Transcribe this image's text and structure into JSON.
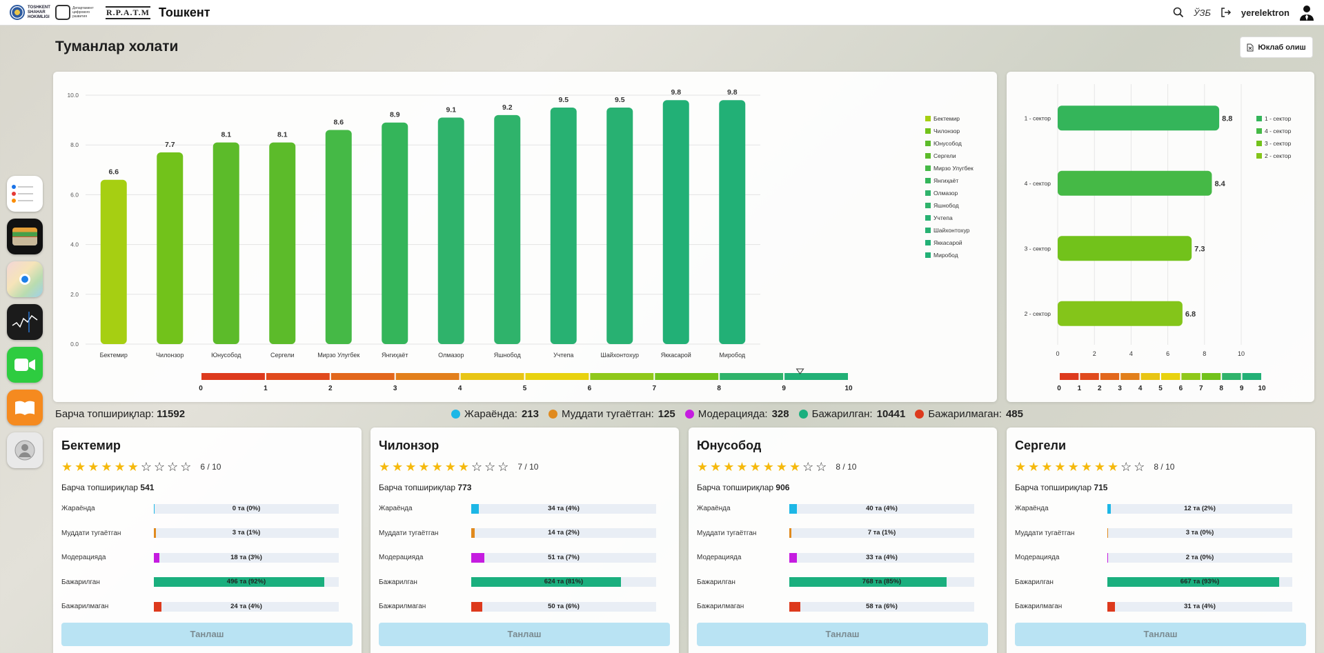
{
  "header": {
    "logo1_text": "TOSHKENT SHAHAR HOKIMLIGI",
    "logo2_text": "Департамент цифрового развития",
    "logo3_text": "R.P.A.T.M",
    "city": "Тошкент",
    "lang": "ЎЗБ",
    "user": "yerelektron"
  },
  "page": {
    "title": "Туманлар холати",
    "download_label": "Юклаб олиш"
  },
  "colors": {
    "lime": "#a6cf12",
    "green_light": "#72c21b",
    "green_mid": "#5cbb2a",
    "green_teal": "#2fb36b",
    "teal": "#1aaf7e",
    "blue": "#1db7e6",
    "orange": "#e08a1e",
    "magenta": "#c51ce0",
    "red": "#dd3a1d"
  },
  "chart_data": [
    {
      "type": "bar",
      "categories": [
        "Бектемир",
        "Чилонзор",
        "Юнусобод",
        "Сергели",
        "Мирзо Улугбек",
        "Янгиҳаёт",
        "Олмазор",
        "Яшнобод",
        "Учтепа",
        "Шайхонтохур",
        "Яккасарой",
        "Миробод"
      ],
      "values": [
        6.6,
        7.7,
        8.1,
        8.1,
        8.6,
        8.9,
        9.1,
        9.2,
        9.5,
        9.5,
        9.8,
        9.8
      ],
      "value_labels": [
        "6.6",
        "7.7",
        "8.1",
        "8.1",
        "8.6",
        "8.9",
        "9.1",
        "9.2",
        "9.5",
        "9.5",
        "9.8",
        "9.8"
      ],
      "bar_colors": [
        "#a6cf12",
        "#72c21b",
        "#5cbb2a",
        "#5cbb2a",
        "#45b946",
        "#34b55a",
        "#2fb36b",
        "#2fb36b",
        "#28b172",
        "#28b172",
        "#22b076",
        "#22b076"
      ],
      "yticks": [
        "0.0",
        "2.0",
        "4.0",
        "6.0",
        "8.0",
        "10.0"
      ],
      "ylim": [
        0,
        10
      ],
      "grid": true,
      "legend": "right",
      "scale_labels": [
        "0",
        "1",
        "2",
        "3",
        "4",
        "5",
        "6",
        "7",
        "8",
        "9",
        "10"
      ],
      "scale_colors": [
        "#dd3a1d",
        "#e04a1d",
        "#e2671c",
        "#e27f1b",
        "#e8c514",
        "#e8d20f",
        "#8fc81a",
        "#72c21b",
        "#2fb36b",
        "#22b076"
      ]
    },
    {
      "type": "bar",
      "orientation": "horizontal",
      "categories": [
        "1 - сектор",
        "4 - сектор",
        "3 - сектор",
        "2 - сектор"
      ],
      "values": [
        8.8,
        8.4,
        7.3,
        6.8
      ],
      "value_labels": [
        "8.8",
        "8.4",
        "7.3",
        "6.8"
      ],
      "bar_colors": [
        "#34b55a",
        "#45b946",
        "#72c21b",
        "#84c51a"
      ],
      "xticks": [
        "0",
        "2",
        "4",
        "6",
        "8",
        "10"
      ],
      "xlim": [
        0,
        10
      ],
      "legend": "right",
      "scale_labels": [
        "0",
        "1",
        "2",
        "3",
        "4",
        "5",
        "6",
        "7",
        "8",
        "9",
        "10"
      ],
      "scale_colors": [
        "#dd3a1d",
        "#e04a1d",
        "#e2671c",
        "#e27f1b",
        "#e8c514",
        "#e8d20f",
        "#8fc81a",
        "#72c21b",
        "#2fb36b",
        "#22b076"
      ]
    }
  ],
  "summary": {
    "total_label": "Барча топшириқлар:",
    "total_value": "11592",
    "stats": [
      {
        "label": "Жараёнда:",
        "value": "213",
        "color": "#1db7e6"
      },
      {
        "label": "Муддати тугаётган:",
        "value": "125",
        "color": "#e08a1e"
      },
      {
        "label": "Модерацияда:",
        "value": "328",
        "color": "#c51ce0"
      },
      {
        "label": "Бажарилган:",
        "value": "10441",
        "color": "#1aaf7e"
      },
      {
        "label": "Бажарилмаган:",
        "value": "485",
        "color": "#dd3a1d"
      }
    ]
  },
  "districts": [
    {
      "name": "Бектемир",
      "rating": 6,
      "score_text": "6 / 10",
      "tasks_label": "Барча топшириқлар",
      "tasks_total": "541",
      "metrics": [
        {
          "label": "Жараёнда",
          "text": "0 та (0%)",
          "pct": 0,
          "color": "#1db7e6"
        },
        {
          "label": "Муддати тугаётган",
          "text": "3 та (1%)",
          "pct": 1,
          "color": "#e08a1e"
        },
        {
          "label": "Модерацияда",
          "text": "18 та (3%)",
          "pct": 3,
          "color": "#c51ce0"
        },
        {
          "label": "Бажарилган",
          "text": "496 та (92%)",
          "pct": 92,
          "color": "#1aaf7e"
        },
        {
          "label": "Бажарилмаган",
          "text": "24 та (4%)",
          "pct": 4,
          "color": "#dd3a1d"
        }
      ],
      "button": "Танлаш"
    },
    {
      "name": "Чилонзор",
      "rating": 7,
      "score_text": "7 / 10",
      "tasks_label": "Барча топшириқлар",
      "tasks_total": "773",
      "metrics": [
        {
          "label": "Жараёнда",
          "text": "34 та (4%)",
          "pct": 4,
          "color": "#1db7e6"
        },
        {
          "label": "Муддати тугаётган",
          "text": "14 та (2%)",
          "pct": 2,
          "color": "#e08a1e"
        },
        {
          "label": "Модерацияда",
          "text": "51 та (7%)",
          "pct": 7,
          "color": "#c51ce0"
        },
        {
          "label": "Бажарилган",
          "text": "624 та (81%)",
          "pct": 81,
          "color": "#1aaf7e"
        },
        {
          "label": "Бажарилмаган",
          "text": "50 та (6%)",
          "pct": 6,
          "color": "#dd3a1d"
        }
      ],
      "button": "Танлаш"
    },
    {
      "name": "Юнусобод",
      "rating": 8,
      "score_text": "8 / 10",
      "tasks_label": "Барча топшириқлар",
      "tasks_total": "906",
      "metrics": [
        {
          "label": "Жараёнда",
          "text": "40 та (4%)",
          "pct": 4,
          "color": "#1db7e6"
        },
        {
          "label": "Муддати тугаётган",
          "text": "7 та (1%)",
          "pct": 1,
          "color": "#e08a1e"
        },
        {
          "label": "Модерацияда",
          "text": "33 та (4%)",
          "pct": 4,
          "color": "#c51ce0"
        },
        {
          "label": "Бажарилган",
          "text": "768 та (85%)",
          "pct": 85,
          "color": "#1aaf7e"
        },
        {
          "label": "Бажарилмаган",
          "text": "58 та (6%)",
          "pct": 6,
          "color": "#dd3a1d"
        }
      ],
      "button": "Танлаш"
    },
    {
      "name": "Сергели",
      "rating": 8,
      "score_text": "8 / 10",
      "tasks_label": "Барча топшириқлар",
      "tasks_total": "715",
      "metrics": [
        {
          "label": "Жараёнда",
          "text": "12 та (2%)",
          "pct": 2,
          "color": "#1db7e6"
        },
        {
          "label": "Муддати тугаётган",
          "text": "3 та (0%)",
          "pct": 0.5,
          "color": "#e08a1e"
        },
        {
          "label": "Модерацияда",
          "text": "2 та (0%)",
          "pct": 0.5,
          "color": "#c51ce0"
        },
        {
          "label": "Бажарилган",
          "text": "667 та (93%)",
          "pct": 93,
          "color": "#1aaf7e"
        },
        {
          "label": "Бажарилмаган",
          "text": "31 та (4%)",
          "pct": 4,
          "color": "#dd3a1d"
        }
      ],
      "button": "Танлаш"
    }
  ],
  "dock": [
    "reminders-icon",
    "wallet-icon",
    "maps-icon",
    "stocks-icon",
    "facetime-icon",
    "books-icon",
    "contacts-icon"
  ]
}
